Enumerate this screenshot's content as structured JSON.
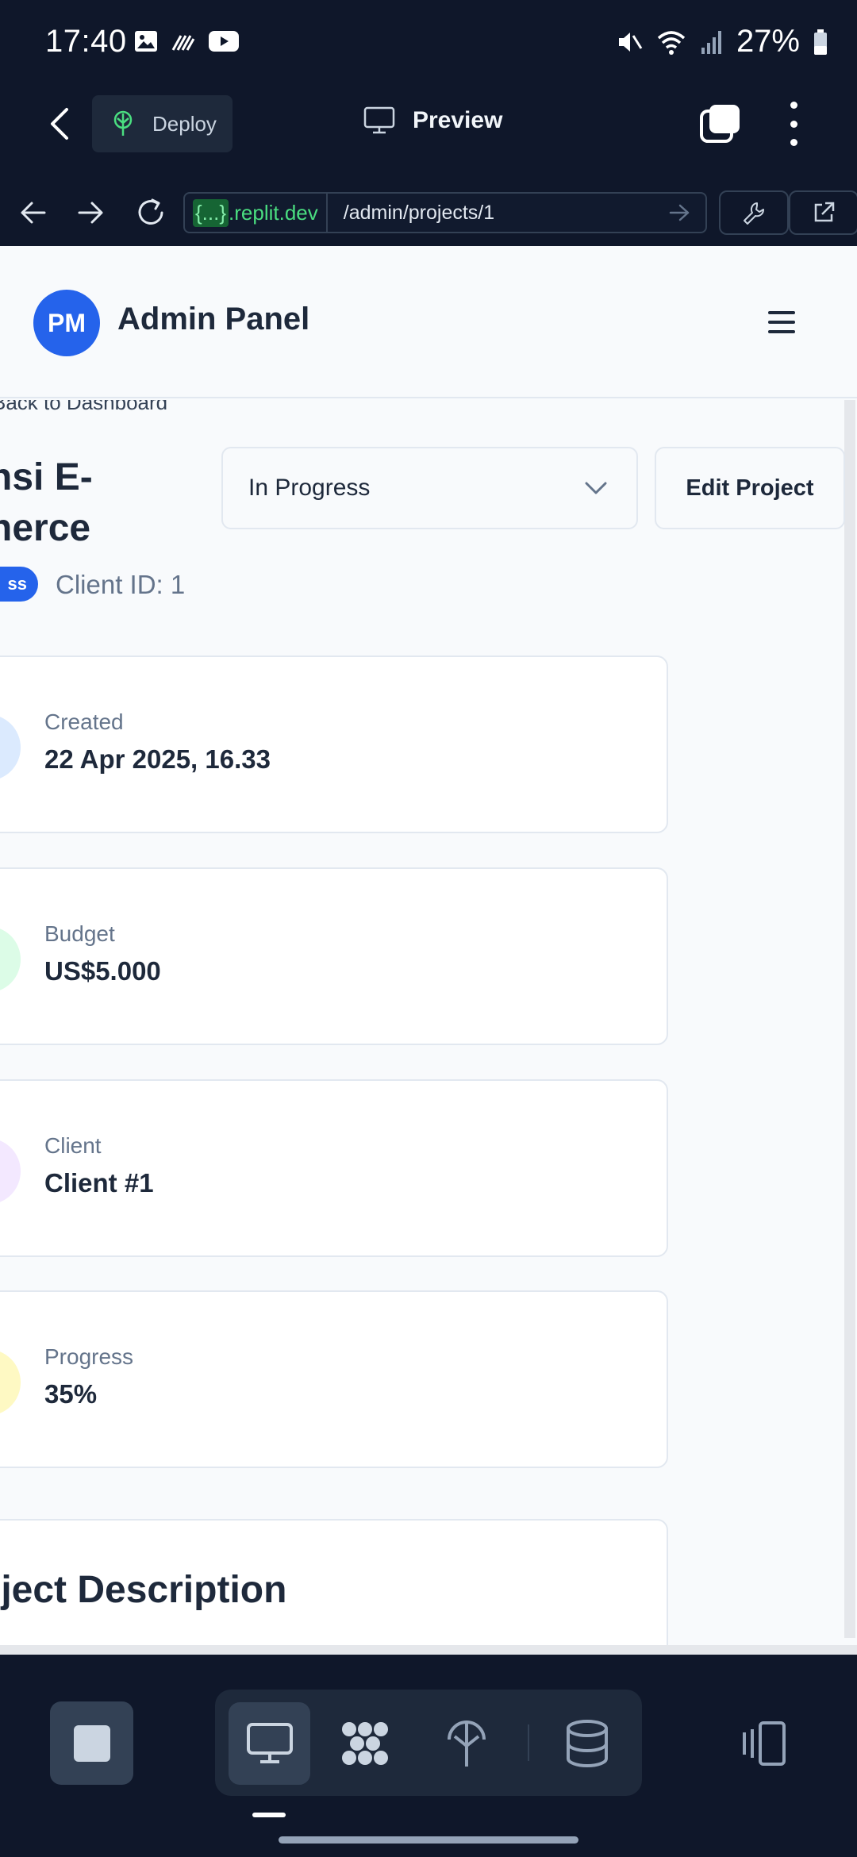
{
  "status_bar": {
    "time": "17:40",
    "battery": "27%"
  },
  "app_header": {
    "deploy_label": "Deploy",
    "preview_label": "Preview"
  },
  "browser": {
    "host_brace": "{...}",
    "host_domain": ".replit.dev",
    "path": "/admin/projects/1"
  },
  "site": {
    "avatar_initials": "PM",
    "title": "Admin Panel"
  },
  "page": {
    "back_link": "Back to Dashboard",
    "project_title": "nsi E-\nnerce",
    "status_pill": "ss",
    "client_id": "Client ID: 1",
    "status_select": "In Progress",
    "edit_button": "Edit Project"
  },
  "cards": [
    {
      "label": "Created",
      "value": "22 Apr 2025, 16.33",
      "color": "#dbeafe"
    },
    {
      "label": "Budget",
      "value": "US$5.000",
      "color": "#dcfce7"
    },
    {
      "label": "Client",
      "value": "Client #1",
      "color": "#f3e8ff"
    },
    {
      "label": "Progress",
      "value": "35%",
      "color": "#fef9c3"
    }
  ],
  "description": {
    "title": "oject Description"
  },
  "colors": {
    "accent": "#2563eb",
    "chrome": "#0f172a",
    "success": "#4ade80"
  },
  "icons": [
    "image-icon",
    "signal-icon",
    "youtube-icon",
    "mute-icon",
    "wifi-icon",
    "cell-icon",
    "battery-icon",
    "back-icon",
    "deploy-icon",
    "monitor-icon",
    "tabs-icon",
    "menu-icon",
    "arrow-left-icon",
    "arrow-right-icon",
    "reload-icon",
    "go-icon",
    "wrench-icon",
    "external-link-icon",
    "hamburger-icon",
    "chevron-down-icon",
    "stop-icon",
    "preview-icon",
    "nodes-icon",
    "deploy-icon",
    "database-icon",
    "layout-icon"
  ]
}
